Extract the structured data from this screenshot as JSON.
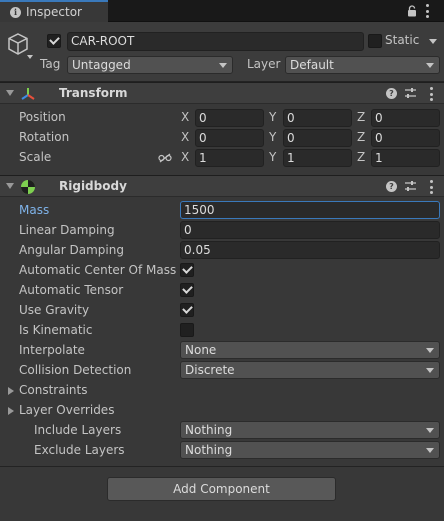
{
  "tab": {
    "label": "Inspector"
  },
  "header": {
    "object_name": "CAR-ROOT",
    "active": true,
    "static_label": "Static",
    "tag_label": "Tag",
    "tag_value": "Untagged",
    "layer_label": "Layer",
    "layer_value": "Default"
  },
  "transform": {
    "title": "Transform",
    "rows": [
      {
        "label": "Position",
        "x": "0",
        "y": "0",
        "z": "0"
      },
      {
        "label": "Rotation",
        "x": "0",
        "y": "0",
        "z": "0"
      },
      {
        "label": "Scale",
        "x": "1",
        "y": "1",
        "z": "1"
      }
    ],
    "axis_x": "X",
    "axis_y": "Y",
    "axis_z": "Z"
  },
  "rigidbody": {
    "title": "Rigidbody",
    "mass_label": "Mass",
    "mass_value": "1500",
    "linear_damping_label": "Linear Damping",
    "linear_damping_value": "0",
    "angular_damping_label": "Angular Damping",
    "angular_damping_value": "0.05",
    "auto_center_label": "Automatic Center Of Mass",
    "auto_center_checked": true,
    "auto_tensor_label": "Automatic Tensor",
    "auto_tensor_checked": true,
    "use_gravity_label": "Use Gravity",
    "use_gravity_checked": true,
    "is_kinematic_label": "Is Kinematic",
    "is_kinematic_checked": false,
    "interpolate_label": "Interpolate",
    "interpolate_value": "None",
    "collision_label": "Collision Detection",
    "collision_value": "Discrete",
    "constraints_label": "Constraints",
    "layer_overrides_label": "Layer Overrides",
    "include_layers_label": "Include Layers",
    "include_layers_value": "Nothing",
    "exclude_layers_label": "Exclude Layers",
    "exclude_layers_value": "Nothing"
  },
  "add_component_label": "Add Component",
  "colors": {
    "panel_bg": "#383838",
    "accent": "#3a79bb",
    "mass_label": "#7fb3e9"
  }
}
